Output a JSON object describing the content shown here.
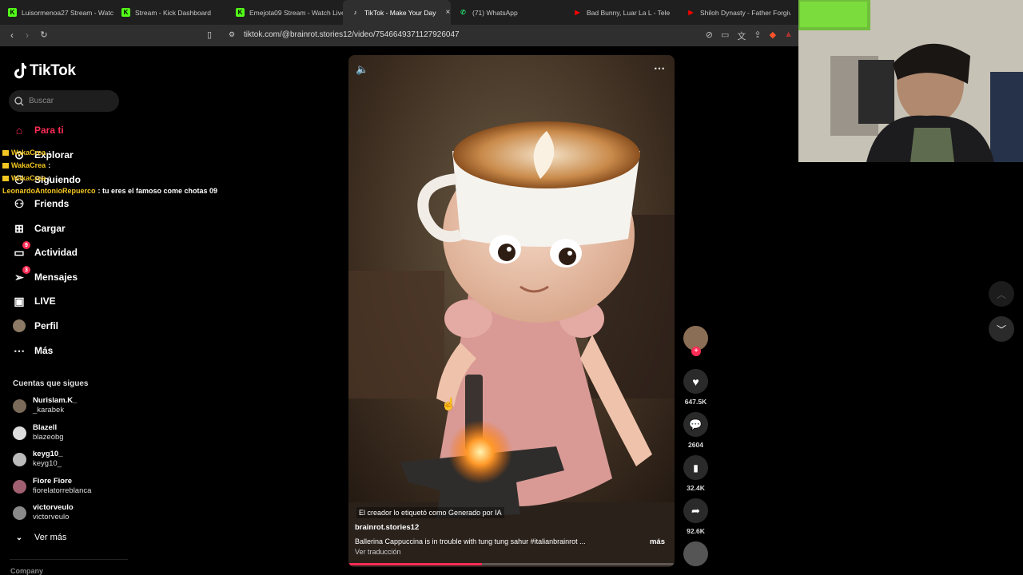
{
  "browser": {
    "tabs": [
      {
        "label": "Luisormenoa27 Stream - Watch",
        "icon": "kick-icon",
        "color": "#53fc18"
      },
      {
        "label": "Stream - Kick Dashboard",
        "icon": "kick-icon",
        "color": "#53fc18"
      },
      {
        "label": "Emejota09 Stream - Watch Live",
        "icon": "kick-icon",
        "color": "#53fc18"
      },
      {
        "label": "TikTok - Make Your Day",
        "icon": "tiktok-icon",
        "color": "#ffffff",
        "active": true
      },
      {
        "label": "(71) WhatsApp",
        "icon": "whatsapp-icon",
        "color": "#25d366"
      },
      {
        "label": "Bad Bunny, Luar La L - Tele",
        "icon": "youtube-icon",
        "color": "#ff0000"
      },
      {
        "label": "Shiloh Dynasty - Father Forgiv",
        "icon": "youtube-icon",
        "color": "#ff0000"
      }
    ],
    "url": "tiktok.com/@brainrot.stories12/video/7546649371127926047"
  },
  "sidebar": {
    "logo": "TikTok",
    "search_placeholder": "Buscar",
    "nav": [
      {
        "label": "Para ti",
        "icon": "home-icon",
        "active": true
      },
      {
        "label": "Explorar",
        "icon": "compass-icon"
      },
      {
        "label": "Siguiendo",
        "icon": "following-icon"
      },
      {
        "label": "Friends",
        "icon": "friends-icon"
      },
      {
        "label": "Cargar",
        "icon": "upload-icon"
      },
      {
        "label": "Actividad",
        "icon": "inbox-icon",
        "badge": "9"
      },
      {
        "label": "Mensajes",
        "icon": "message-icon",
        "badge": "3"
      },
      {
        "label": "LIVE",
        "icon": "live-icon"
      },
      {
        "label": "Perfil",
        "icon": "profile-icon"
      },
      {
        "label": "Más",
        "icon": "more-icon"
      }
    ],
    "following_title": "Cuentas que sigues",
    "following": [
      {
        "name": "Nurislam.K_",
        "handle": "_karabek"
      },
      {
        "name": "Blazell",
        "handle": "blazeobg"
      },
      {
        "name": "keyg10_",
        "handle": "keyg10_"
      },
      {
        "name": "Fiore Fiore",
        "handle": "fiorelatorreblanca"
      },
      {
        "name": "victorveulo",
        "handle": "victorveulo"
      }
    ],
    "see_more": "Ver más",
    "company": "Company"
  },
  "chat_overlay": [
    {
      "user": "WakaCrea",
      "msg": ":"
    },
    {
      "user": "WakaCrea",
      "msg": ":"
    },
    {
      "user": "WakaCrea",
      "msg": ":"
    },
    {
      "user": "LeonardoAntonioRepuerco",
      "msg": ": tu eres el famoso come chotas 09"
    }
  ],
  "video": {
    "ai_label": "El creador lo etiquetó como Generado por IA",
    "author": "brainrot.stories12",
    "caption": "Ballerina Cappuccina is in trouble with tung tung sahur #italianbrainrot ...",
    "more": "más",
    "translate": "Ver traducción",
    "progress": 0.41
  },
  "actions": {
    "likes": "647.5K",
    "comments": "2604",
    "saves": "32.4K",
    "shares": "92.6K"
  }
}
